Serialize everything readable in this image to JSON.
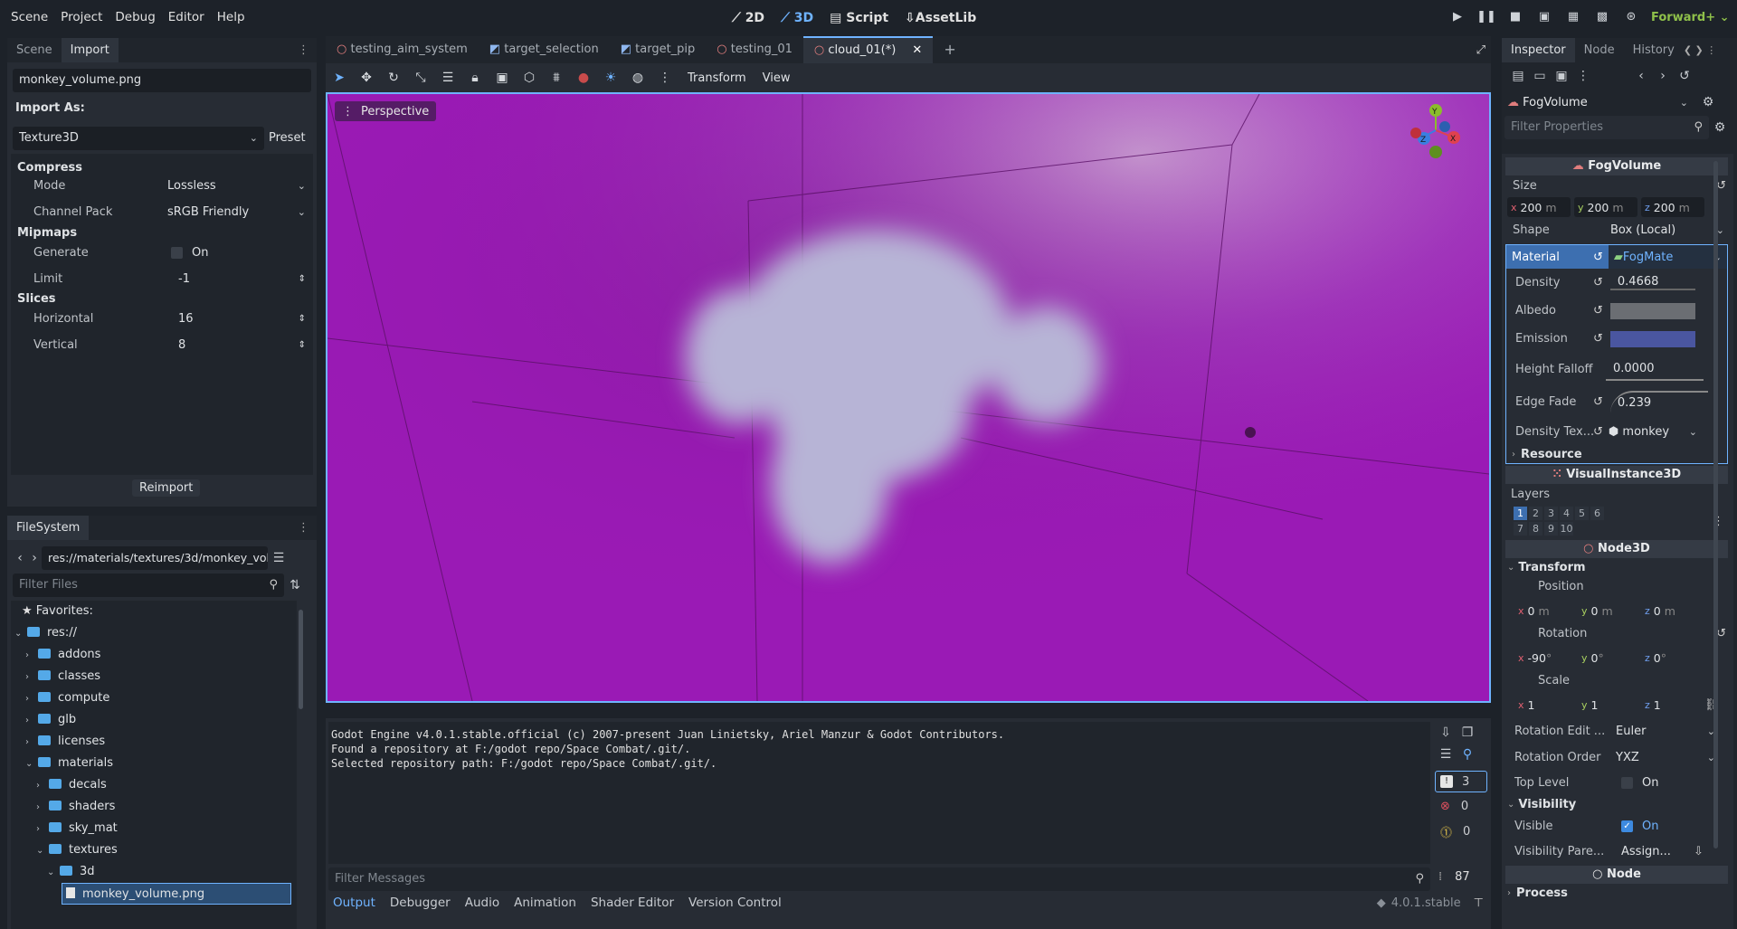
{
  "menubar": {
    "items": [
      "Scene",
      "Project",
      "Debug",
      "Editor",
      "Help"
    ],
    "modes": {
      "m2d": "2D",
      "m3d": "3D",
      "script": "Script",
      "assetlib": "AssetLib"
    },
    "renderer": "Forward+"
  },
  "left_top": {
    "tabs": [
      "Scene",
      "Import"
    ],
    "file": "monkey_volume.png",
    "import_as_label": "Import As:",
    "import_as_value": "Texture3D",
    "preset": "Preset",
    "compress": {
      "title": "Compress",
      "mode_label": "Mode",
      "mode_value": "Lossless",
      "channel_label": "Channel Pack",
      "channel_value": "sRGB Friendly"
    },
    "mipmaps": {
      "title": "Mipmaps",
      "generate_label": "Generate",
      "generate_value": "On",
      "limit_label": "Limit",
      "limit_value": "-1"
    },
    "slices": {
      "title": "Slices",
      "h_label": "Horizontal",
      "h_value": "16",
      "v_label": "Vertical",
      "v_value": "8"
    },
    "reimport": "Reimport"
  },
  "filesystem": {
    "title": "FileSystem",
    "path": "res://materials/textures/3d/monkey_vol",
    "filter": "Filter Files",
    "favorites": "Favorites:",
    "tree": [
      "res://",
      "addons",
      "classes",
      "compute",
      "glb",
      "licenses",
      "materials",
      "decals",
      "shaders",
      "sky_mat",
      "textures",
      "3d",
      "monkey_volume.png"
    ]
  },
  "doc_tabs": [
    "testing_aim_system",
    "target_selection",
    "target_pip",
    "testing_01",
    "cloud_01(*)"
  ],
  "toolbar": {
    "transform": "Transform",
    "view": "View"
  },
  "viewport": {
    "perspective": "Perspective",
    "gizmo": {
      "x": "X",
      "y": "Y",
      "z": "Z"
    }
  },
  "output": {
    "lines": [
      "Godot Engine v4.0.1.stable.official (c) 2007-present Juan Linietsky, Ariel Manzur & Godot Contributors.",
      "Found a repository at F:/godot repo/Space Combat/.git/.",
      "Selected repository path: F:/godot repo/Space Combat/.git/."
    ],
    "filter": "Filter Messages",
    "counts": {
      "messages": "3",
      "errors": "0",
      "warnings": "0",
      "lines": "87"
    }
  },
  "bottom_tabs": [
    "Output",
    "Debugger",
    "Audio",
    "Animation",
    "Shader Editor",
    "Version Control"
  ],
  "version": "4.0.1.stable",
  "inspector": {
    "tabs": [
      "Inspector",
      "Node",
      "History"
    ],
    "node_type": "FogVolume",
    "filter": "Filter Properties",
    "class_title": "FogVolume",
    "size_label": "Size",
    "size": {
      "x": "200",
      "y": "200",
      "z": "200",
      "unit": "m"
    },
    "shape_label": "Shape",
    "shape_value": "Box (Local)",
    "material_label": "Material",
    "material_value": "FogMate",
    "density_label": "Density",
    "density_value": "0.4668",
    "albedo_label": "Albedo",
    "emission_label": "Emission",
    "height_falloff_label": "Height Falloff",
    "height_falloff_value": "0.0000",
    "edge_fade_label": "Edge Fade",
    "edge_fade_value": "0.239",
    "density_tex_label": "Density Tex...",
    "density_tex_value": "monkey",
    "resource_label": "Resource",
    "visual_title": "VisualInstance3D",
    "layers_label": "Layers",
    "layers": [
      "1",
      "2",
      "3",
      "4",
      "5",
      "6",
      "7",
      "8",
      "9",
      "10"
    ],
    "node3d_title": "Node3D",
    "transform_label": "Transform",
    "position_label": "Position",
    "position": {
      "x": "0",
      "y": "0",
      "z": "0",
      "unit": "m"
    },
    "rotation_label": "Rotation",
    "rotation": {
      "x": "-90",
      "y": "0",
      "z": "0",
      "unit": "°"
    },
    "scale_label": "Scale",
    "scale": {
      "x": "1",
      "y": "1",
      "z": "1"
    },
    "rot_edit_label": "Rotation Edit ...",
    "rot_edit_value": "Euler",
    "rot_order_label": "Rotation Order",
    "rot_order_value": "YXZ",
    "top_level_label": "Top Level",
    "top_level_value": "On",
    "visibility_label": "Visibility",
    "visible_label": "Visible",
    "visible_value": "On",
    "vis_parent_label": "Visibility Pare...",
    "vis_parent_value": "Assign...",
    "node_title": "Node",
    "process_label": "Process"
  },
  "colors": {
    "accent": "#6fb3ff",
    "viewport": "#9b1fb4",
    "albedo": "#6b6e73",
    "emission": "#4a56a0",
    "folder": "#54a9e8"
  }
}
